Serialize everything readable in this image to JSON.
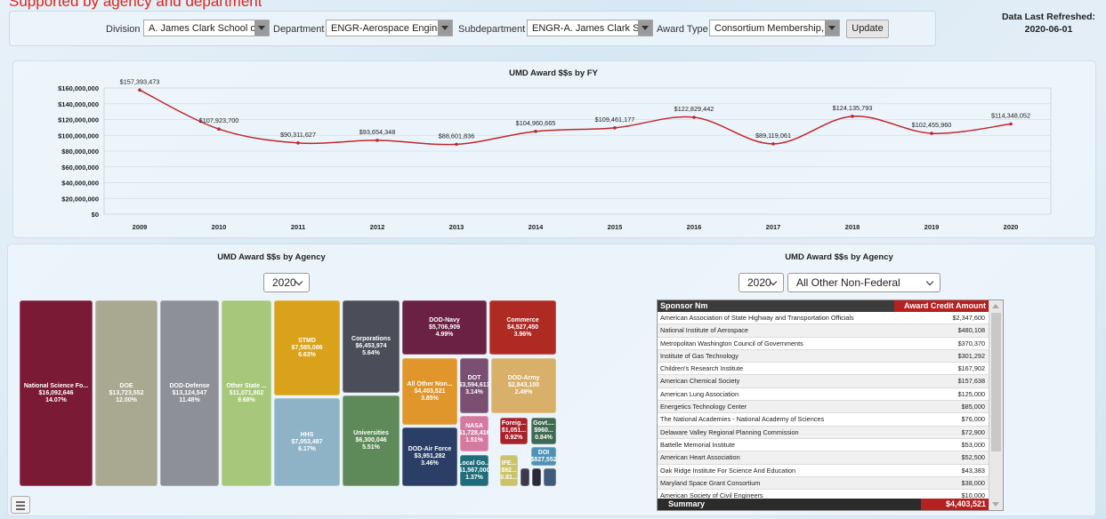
{
  "topnote": "Supported by agency and department",
  "filters": {
    "division_label": "Division",
    "division_value": "A. James Clark School of",
    "department_label": "Department",
    "department_value": "ENGR-Aerospace Engine",
    "subdepartment_label": "Subdepartment",
    "subdepartment_value": "ENGR-A. James Clark Sc",
    "award_type_label": "Award Type",
    "award_type_value": "Consortium Membership,",
    "update_label": "Update"
  },
  "refresh": {
    "label": "Data Last Refreshed:",
    "date": "2020-06-01"
  },
  "line_title": "UMD Award $$s by FY",
  "agency_title_left": "UMD Award $$s by Agency",
  "agency_title_right": "UMD Award $$s by Agency",
  "year_select_left": "2020",
  "year_select_right": "2020",
  "sponsor_type_select": "All Other Non-Federal",
  "colors": {
    "line": "#c0262d",
    "accent_red": "#b52020"
  },
  "chart_data": [
    {
      "type": "line",
      "title": "UMD Award $$s by FY",
      "x": [
        "2009",
        "2010",
        "2011",
        "2012",
        "2013",
        "2014",
        "2015",
        "2016",
        "2017",
        "2018",
        "2019",
        "2020"
      ],
      "values": [
        157393473,
        107923700,
        90311627,
        93654348,
        88601836,
        104960665,
        109461177,
        122829442,
        89119061,
        124135793,
        102455960,
        114348052
      ],
      "value_labels": [
        "$157,393,473",
        "$107,923,700",
        "$90,311,627",
        "$93,654,348",
        "$88,601,836",
        "$104,960,665",
        "$109,461,177",
        "$122,829,442",
        "$89,119,061",
        "$124,135,793",
        "$102,455,960",
        "$114,348,052"
      ],
      "yticks": [
        "$160,000,000",
        "$140,000,000",
        "$120,000,000",
        "$100,000,000",
        "$80,000,000",
        "$60,000,000",
        "$40,000,000",
        "$20,000,000",
        "$0"
      ],
      "ylim": [
        0,
        160000000
      ],
      "grid": true
    },
    {
      "type": "treemap",
      "title": "UMD Award $$s by Agency",
      "items": [
        {
          "name": "National Science Fo...",
          "value": "$16,092,646",
          "pct": "14.07%",
          "color": "#7b1a34"
        },
        {
          "name": "DOE",
          "value": "$13,723,552",
          "pct": "12.00%",
          "color": "#a9a890"
        },
        {
          "name": "DOD-Defense",
          "value": "$13,124,547",
          "pct": "11.48%",
          "color": "#8e9098"
        },
        {
          "name": "Other State ...",
          "value": "$11,071,802",
          "pct": "9.68%",
          "color": "#a7c77a"
        },
        {
          "name": "STMD",
          "value": "$7,585,086",
          "pct": "6.63%",
          "color": "#d9a21a"
        },
        {
          "name": "HHS",
          "value": "$7,053,487",
          "pct": "6.17%",
          "color": "#8fb3c6"
        },
        {
          "name": "Corporations",
          "value": "$6,453,974",
          "pct": "5.64%",
          "color": "#4b4e59"
        },
        {
          "name": "Universities",
          "value": "$6,300,046",
          "pct": "5.51%",
          "color": "#5e8a5a"
        },
        {
          "name": "DOD-Navy",
          "value": "$5,706,909",
          "pct": "4.99%",
          "color": "#6b2143"
        },
        {
          "name": "Commerce",
          "value": "$4,527,450",
          "pct": "3.96%",
          "color": "#b02a24"
        },
        {
          "name": "All Other Non...",
          "value": "$4,403,521",
          "pct": "3.85%",
          "color": "#e0962a"
        },
        {
          "name": "DOD-Air Force",
          "value": "$3,951,282",
          "pct": "3.46%",
          "color": "#2b3f66"
        },
        {
          "name": "DOT",
          "value": "$3,594,613",
          "pct": "3.14%",
          "color": "#7a4f72"
        },
        {
          "name": "DOD-Army",
          "value": "$2,843,100",
          "pct": "2.49%",
          "color": "#d8b06a"
        },
        {
          "name": "NASA",
          "value": "$1,728,416",
          "pct": "1.51%",
          "color": "#d47aa0"
        },
        {
          "name": "Local Go...",
          "value": "$1,567,000",
          "pct": "1.37%",
          "color": "#1f6d7a"
        },
        {
          "name": "Foreig...",
          "value": "$1,051...",
          "pct": "0.92%",
          "color": "#a8222c"
        },
        {
          "name": "Govt....",
          "value": "$960...",
          "pct": "0.84%",
          "color": "#3f6a52"
        },
        {
          "name": "DOI",
          "value": "$827,552",
          "pct": "",
          "color": "#4e92b8"
        },
        {
          "name": "IFE...",
          "value": "$92...",
          "pct": "0.81...",
          "color": "#c9c36a"
        }
      ]
    }
  ],
  "table": {
    "col_sponsor": "Sponsor Nm",
    "col_amount": "Award Credit Amount",
    "rows": [
      {
        "sponsor": "American Association of State Highway and Transportation Officials",
        "amount": "$2,347,600"
      },
      {
        "sponsor": "National Institute of Aerospace",
        "amount": "$480,108"
      },
      {
        "sponsor": "Metropolitan Washington Council of Governments",
        "amount": "$370,370"
      },
      {
        "sponsor": "Institute of Gas Technology",
        "amount": "$301,292"
      },
      {
        "sponsor": "Children's Research Institute",
        "amount": "$167,902"
      },
      {
        "sponsor": "American Chemical Society",
        "amount": "$157,638"
      },
      {
        "sponsor": "American Lung Association",
        "amount": "$125,000"
      },
      {
        "sponsor": "Energetics Technology Center",
        "amount": "$85,000"
      },
      {
        "sponsor": "The National Academies - National Academy of Sciences",
        "amount": "$76,000"
      },
      {
        "sponsor": "Delaware Valley Regional Planning Commission",
        "amount": "$72,900"
      },
      {
        "sponsor": "Battelle Memorial Institute",
        "amount": "$53,000"
      },
      {
        "sponsor": "American Heart Association",
        "amount": "$52,500"
      },
      {
        "sponsor": "Oak Ridge Institute For Science And Education",
        "amount": "$43,383"
      },
      {
        "sponsor": "Maryland Space Grant Consortium",
        "amount": "$38,000"
      },
      {
        "sponsor": "American Society of Civil Engineers",
        "amount": "$10,000"
      }
    ],
    "summary_label": "Summary",
    "summary_value": "$4,403,521"
  }
}
